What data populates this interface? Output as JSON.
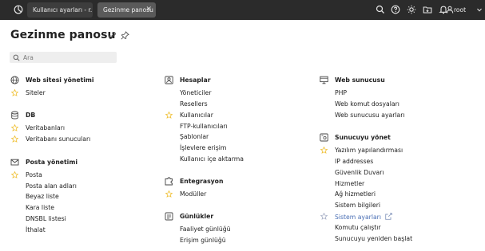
{
  "topbar": {
    "tabs": [
      {
        "label": "Kullanıcı ayarları - r..."
      },
      {
        "label": "Gezinme panosu",
        "close": "✕"
      }
    ],
    "user": "root"
  },
  "page": {
    "title": "Gezinme panosu"
  },
  "search": {
    "placeholder": "Ara"
  },
  "col1": {
    "web_yonetimi": {
      "title": "Web sitesi yönetimi",
      "items": [
        "Siteler"
      ]
    },
    "db": {
      "title": "DB",
      "items": [
        "Veritabanları",
        "Veritabanı sunucuları"
      ]
    },
    "posta": {
      "title": "Posta yönetimi",
      "items": [
        "Posta",
        "Posta alan adları",
        "Beyaz liste",
        "Kara liste",
        "DNSBL listesi",
        "İthalat"
      ]
    }
  },
  "col2": {
    "hesaplar": {
      "title": "Hesaplar",
      "items": [
        "Yöneticiler",
        "Resellers",
        "Kullanıcılar",
        "FTP-kullanıcıları",
        "Şablonlar",
        "İşlevlere erişim",
        "Kullanıcı içe aktarma"
      ]
    },
    "entegrasyon": {
      "title": "Entegrasyon",
      "items": [
        "Modüller"
      ]
    },
    "gunlukler": {
      "title": "Günlükler",
      "items": [
        "Faaliyet günlüğü",
        "Erişim günlüğü"
      ]
    }
  },
  "col3": {
    "web_sunucusu": {
      "title": "Web sunucusu",
      "items": [
        "PHP",
        "Web komut dosyaları",
        "Web sunucusu ayarları"
      ]
    },
    "sunucu": {
      "title": "Sunucuyu yönet",
      "items": [
        "Yazılım yapılandırması",
        "IP addresses",
        "Güvenlik Duvarı",
        "Hizmetler",
        "Ağ hizmetleri",
        "Sistem bilgileri",
        "Sistem ayarları",
        "Komutu çalıştır",
        "Sunucuyu yeniden başlat"
      ]
    }
  },
  "colors": {
    "topbar": "#2b2b2b",
    "star": "#f0c23a",
    "star_outline": "#aab2c8",
    "link_selected": "#4a6fb5"
  }
}
